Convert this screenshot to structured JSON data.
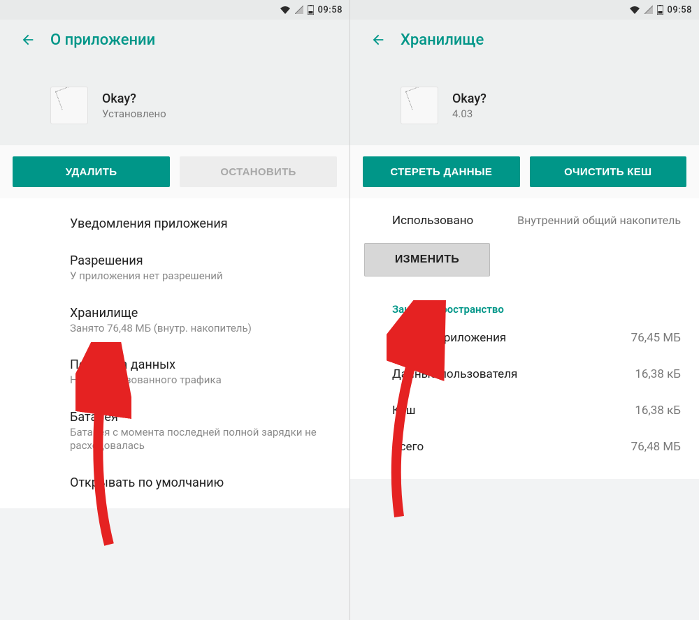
{
  "status": {
    "time": "09:58"
  },
  "left": {
    "title": "О приложении",
    "app": {
      "name": "Okay?",
      "status": "Установлено"
    },
    "buttons": {
      "uninstall": "УДАЛИТЬ",
      "stop": "ОСТАНОВИТЬ"
    },
    "items": [
      {
        "title": "Уведомления приложения",
        "sub": ""
      },
      {
        "title": "Разрешения",
        "sub": "У приложения нет разрешений"
      },
      {
        "title": "Хранилище",
        "sub": "Занято 76,48 МБ (внутр. накопитель)"
      },
      {
        "title": "Передача данных",
        "sub": "Нет использованного трафика"
      },
      {
        "title": "Батарея",
        "sub": "Батарея с момента последней полной зарядки не расходовалась"
      },
      {
        "title": "Открывать по умолчанию",
        "sub": ""
      }
    ]
  },
  "right": {
    "title": "Хранилище",
    "app": {
      "name": "Okay?",
      "version": "4.03"
    },
    "buttons": {
      "clear_data": "СТЕРЕТЬ ДАННЫЕ",
      "clear_cache": "ОЧИСТИТЬ КЕШ"
    },
    "usage": {
      "label": "Использовано",
      "location": "Внутренний общий накопитель"
    },
    "change_btn": "ИЗМЕНИТЬ",
    "section_title": "Занятое пространство",
    "rows": [
      {
        "k": "Размер приложения",
        "v": "76,45 МБ"
      },
      {
        "k": "Данные пользователя",
        "v": "16,38 кБ"
      },
      {
        "k": "Кеш",
        "v": "16,38 кБ"
      },
      {
        "k": "Всего",
        "v": "76,48 МБ"
      }
    ]
  },
  "colors": {
    "accent": "#009688",
    "arrow": "#e52222"
  }
}
